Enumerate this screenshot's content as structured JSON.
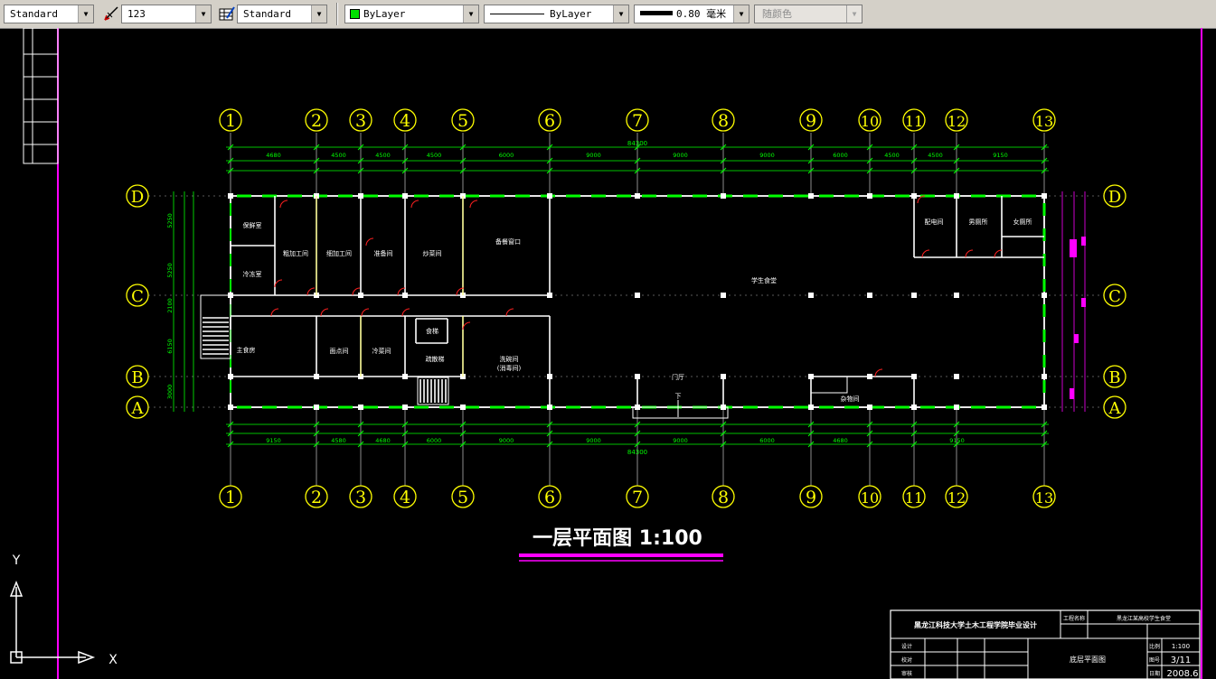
{
  "toolbar": {
    "text_style": "Standard",
    "dim_style": "123",
    "table_style": "Standard",
    "color": "ByLayer",
    "linetype": "ByLayer",
    "lineweight": "0.80 毫米",
    "plot_style": "随颜色"
  },
  "drawing": {
    "title": "一层平面图  1:100",
    "axes_numeric": [
      "1",
      "2",
      "3",
      "4",
      "5",
      "6",
      "7",
      "8",
      "9",
      "10",
      "11",
      "12",
      "13"
    ],
    "axes_letter": [
      "D",
      "C",
      "B",
      "A"
    ],
    "total_dim": "84300",
    "top_spans": [
      "4680",
      "4500",
      "4500",
      "4500",
      "6000",
      "9000",
      "9000",
      "9000",
      "6000",
      "4500",
      "4500",
      "9150"
    ],
    "bottom_spans": [
      "9150",
      "4580",
      "4680",
      "6000",
      "9000",
      "9000",
      "9000",
      "6000",
      "4680",
      "9150"
    ],
    "left_dims": [
      "5250",
      "5250",
      "2100",
      "6150",
      "3000"
    ],
    "rooms": {
      "r1": "保鲜室",
      "r2": "冷冻室",
      "r3": "粗加工间",
      "r4": "细加工间",
      "r5": "准备间",
      "r6": "炒菜间",
      "r7": "备餐窗口",
      "r8": "学生食堂",
      "r9": "配电间",
      "r10": "男厕所",
      "r11": "女厕所",
      "r12": "主食房",
      "r13": "面点间",
      "r14": "冷菜间",
      "r15": "食梯",
      "r16": "疏散梯",
      "r17": "洗碗间",
      "r17b": "(消毒间)",
      "r18": "门厅",
      "r19": "杂物间"
    },
    "entrance_mark": "下"
  },
  "title_block": {
    "school": "黑龙江科技大学土木工程学院毕业设计",
    "project_label": "工程名称",
    "project": "黑龙江某高校学生食堂",
    "drawing_name": "底层平面图",
    "sheet_no": "3/11",
    "date": "2008.6",
    "scale_label": "比例",
    "scale": "1:100",
    "sheet_label": "图号",
    "date_label": "日期",
    "rows": [
      "设计",
      "校对",
      "审核"
    ]
  },
  "ucs": {
    "x": "X",
    "y": "Y"
  },
  "colors": {
    "background": "#000000",
    "axis": "#ffff00",
    "dimension": "#00ff00",
    "wall": "#ffffff",
    "door": "#ff2020",
    "border": "#ff00ff"
  }
}
